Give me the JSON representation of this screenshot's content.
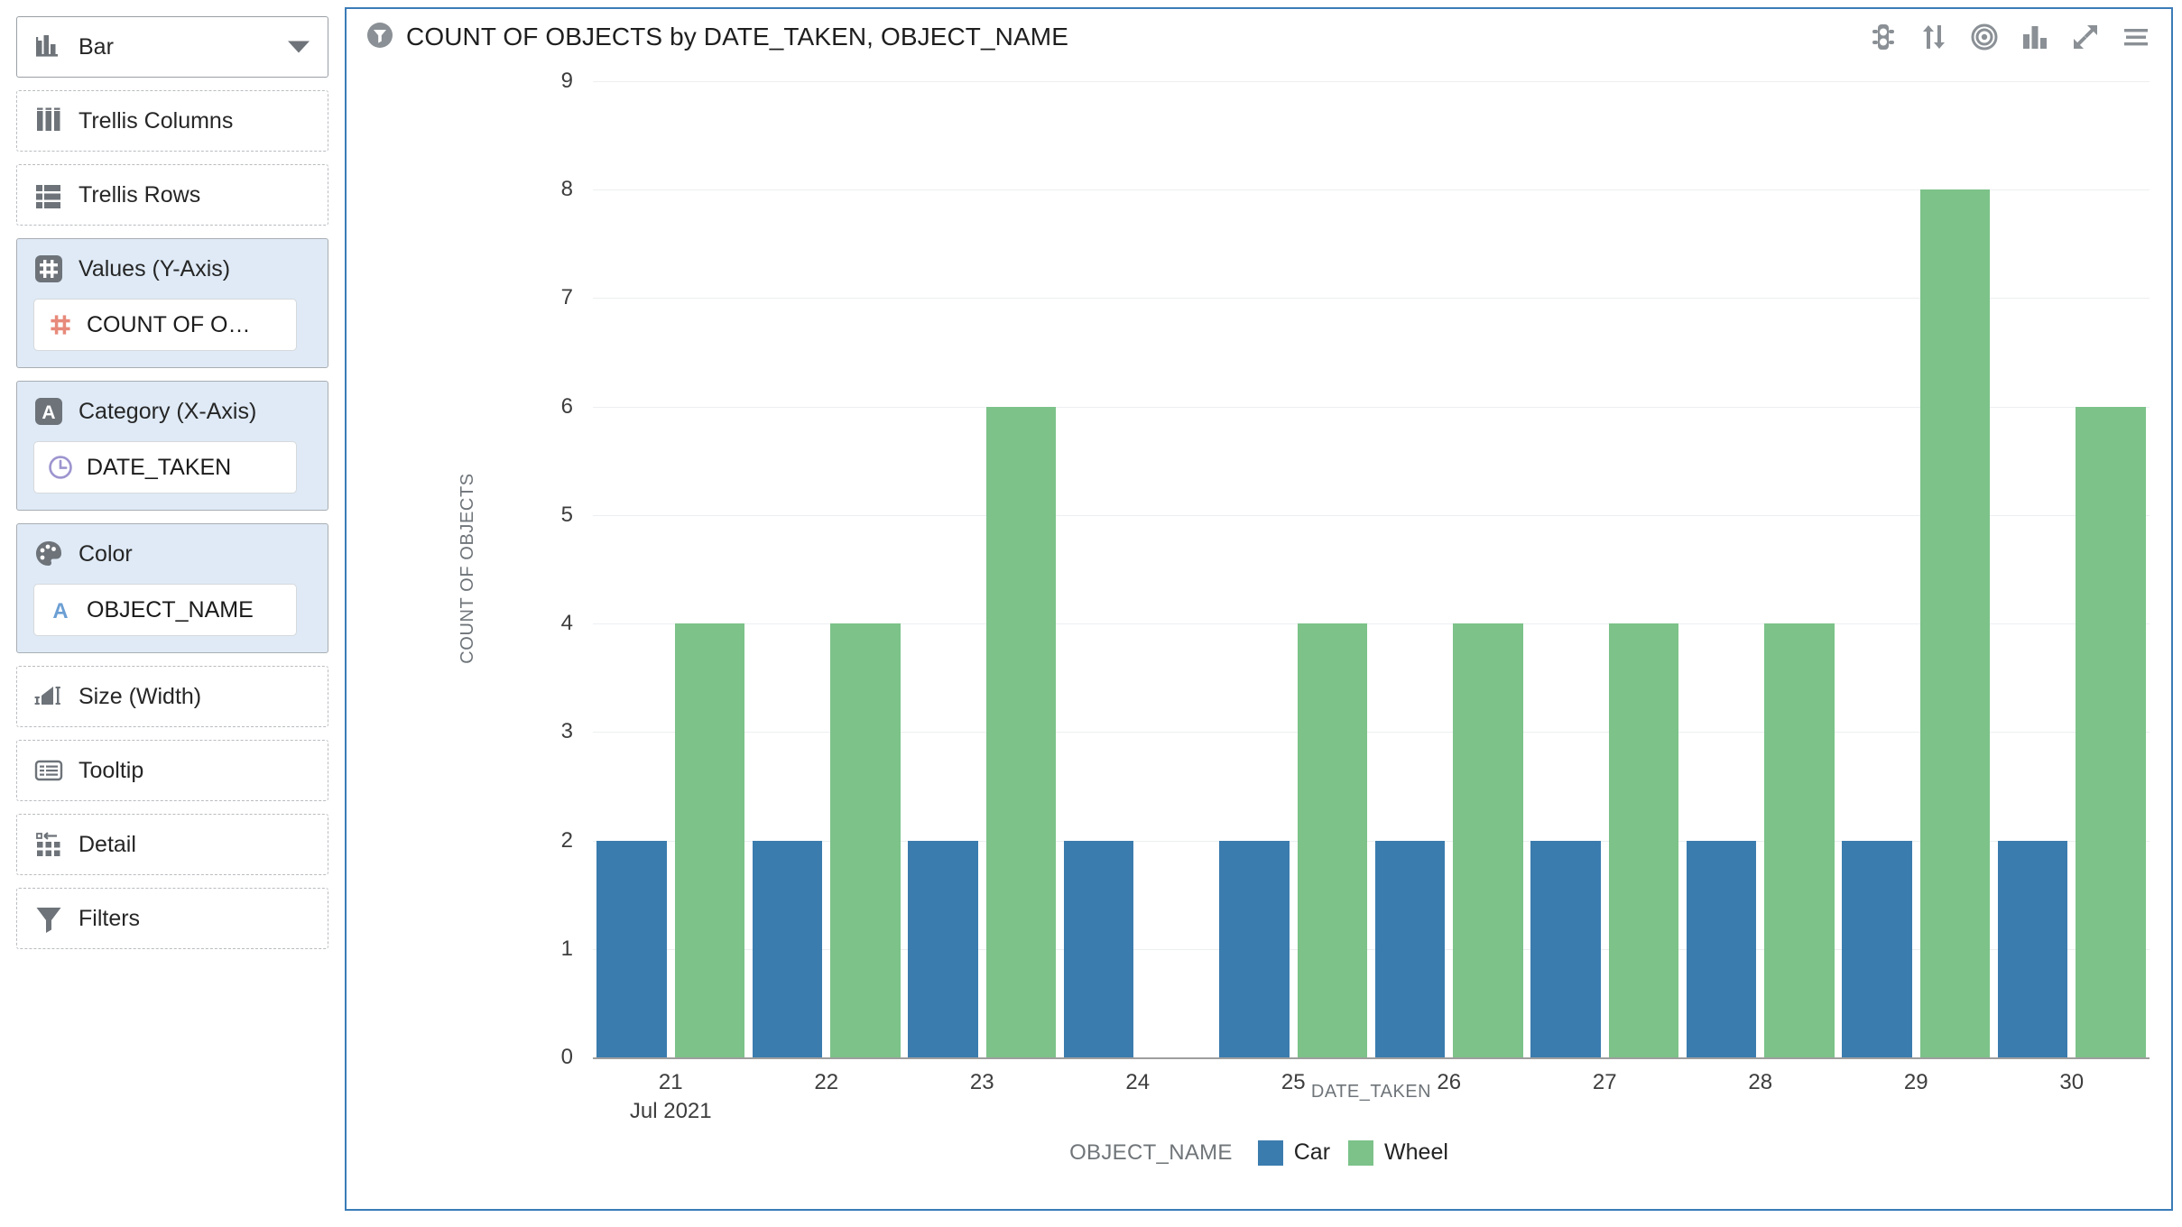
{
  "shelves": [
    {
      "key": "chart_type",
      "icon": "bar-chart-icon",
      "label": "Bar",
      "state": "solid",
      "caret": true
    },
    {
      "key": "trellis_columns",
      "icon": "trellis-columns-icon",
      "label": "Trellis Columns",
      "state": "empty"
    },
    {
      "key": "trellis_rows",
      "icon": "trellis-rows-icon",
      "label": "Trellis Rows",
      "state": "empty"
    },
    {
      "key": "values_y",
      "icon": "numeric-hash-icon",
      "label": "Values (Y-Axis)",
      "state": "filled",
      "pill": {
        "icon": "numeric-hash-icon",
        "label": "COUNT OF O…",
        "color": "#e78a7b"
      }
    },
    {
      "key": "category_x",
      "icon": "text-a-icon",
      "label": "Category (X-Axis)",
      "state": "filled",
      "pill": {
        "icon": "clock-icon",
        "label": "DATE_TAKEN",
        "color": "#9d95cf"
      }
    },
    {
      "key": "color",
      "icon": "palette-icon",
      "label": "Color",
      "state": "filled",
      "pill": {
        "icon": "text-a-icon",
        "label": "OBJECT_NAME",
        "color": "#6c9fd4"
      }
    },
    {
      "key": "size_width",
      "icon": "size-width-icon",
      "label": "Size (Width)",
      "state": "empty"
    },
    {
      "key": "tooltip",
      "icon": "tooltip-icon",
      "label": "Tooltip",
      "state": "empty"
    },
    {
      "key": "detail",
      "icon": "detail-icon",
      "label": "Detail",
      "state": "empty"
    },
    {
      "key": "filters",
      "icon": "funnel-icon",
      "label": "Filters",
      "state": "empty"
    }
  ],
  "header": {
    "title_icon": "filter-funnel-badge-icon",
    "title": "COUNT OF OBJECTS by DATE_TAKEN, OBJECT_NAME",
    "toolbar": [
      {
        "name": "conditional-formatting-icon",
        "tip": "traffic-light"
      },
      {
        "name": "sort-icon",
        "tip": "sort"
      },
      {
        "name": "target-icon",
        "tip": "focus"
      },
      {
        "name": "chart-icon",
        "tip": "chart"
      },
      {
        "name": "expand-icon",
        "tip": "maximize"
      },
      {
        "name": "menu-icon",
        "tip": "menu"
      }
    ]
  },
  "chart_data": {
    "type": "bar",
    "title": "COUNT OF OBJECTS by DATE_TAKEN, OBJECT_NAME",
    "xlabel": "DATE_TAKEN",
    "ylabel": "COUNT OF OBJECTS",
    "ylim": [
      0,
      9
    ],
    "yticks": [
      0,
      1,
      2,
      3,
      4,
      5,
      6,
      7,
      8,
      9
    ],
    "grid": true,
    "legend_title": "OBJECT_NAME",
    "legend_position": "bottom",
    "categories": [
      "21",
      "22",
      "23",
      "24",
      "25",
      "26",
      "27",
      "28",
      "29",
      "30"
    ],
    "category_sublabels": [
      "Jul 2021",
      "",
      "",
      "",
      "",
      "",
      "",
      "",
      "",
      ""
    ],
    "series": [
      {
        "name": "Car",
        "color": "#3b7cae",
        "values": [
          2,
          2,
          2,
          2,
          2,
          2,
          2,
          2,
          2,
          2
        ]
      },
      {
        "name": "Wheel",
        "color": "#7cc289",
        "values": [
          4,
          4,
          6,
          null,
          4,
          4,
          4,
          4,
          8,
          6
        ]
      }
    ]
  }
}
